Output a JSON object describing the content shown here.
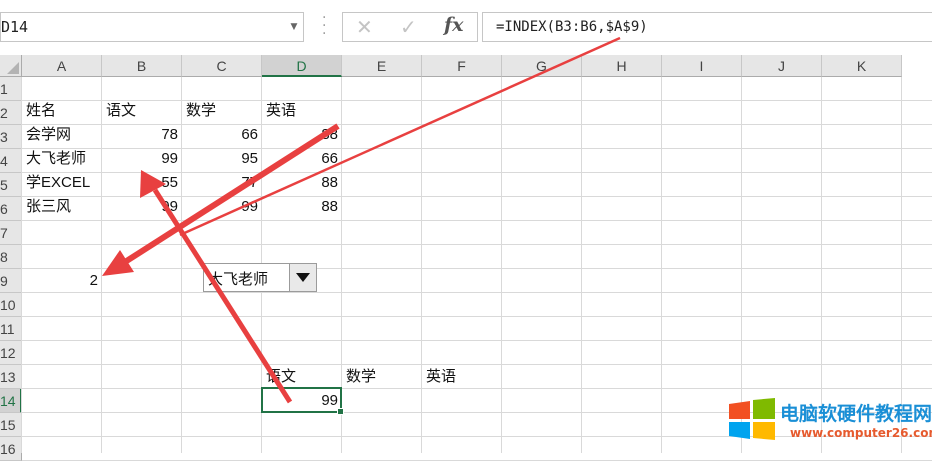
{
  "name_box": {
    "value": "D14"
  },
  "formula_bar": {
    "cancel_icon": "✕",
    "enter_icon": "✓",
    "fx_label": "fx",
    "formula": "=INDEX(B3:B6,$A$9)"
  },
  "columns": [
    "A",
    "B",
    "C",
    "D",
    "E",
    "F",
    "G",
    "H",
    "I",
    "J",
    "K"
  ],
  "selected_column": "D",
  "rows": [
    "1",
    "2",
    "3",
    "4",
    "5",
    "6",
    "7",
    "8",
    "9",
    "10",
    "11",
    "12",
    "13",
    "14",
    "15",
    "16"
  ],
  "selected_row": "14",
  "table": {
    "headers": [
      "姓名",
      "语文",
      "数学",
      "英语"
    ],
    "records": [
      {
        "name": "会学网",
        "chinese": "78",
        "math": "66",
        "english": "88"
      },
      {
        "name": "大飞老师",
        "chinese": "99",
        "math": "95",
        "english": "66"
      },
      {
        "name": "学EXCEL",
        "chinese": "55",
        "math": "77",
        "english": "88"
      },
      {
        "name": "张三风",
        "chinese": "99",
        "math": "99",
        "english": "88"
      }
    ]
  },
  "cell_a9": "2",
  "dropdown": {
    "selected": "大飞老师"
  },
  "lookup": {
    "headers": [
      "语文",
      "数学",
      "英语"
    ],
    "result": "99"
  },
  "colors": {
    "accent_green": "#217346",
    "arrow_red": "#e84040"
  },
  "watermark": {
    "title": "电脑软硬件教程网",
    "url": "www.computer26.com"
  }
}
